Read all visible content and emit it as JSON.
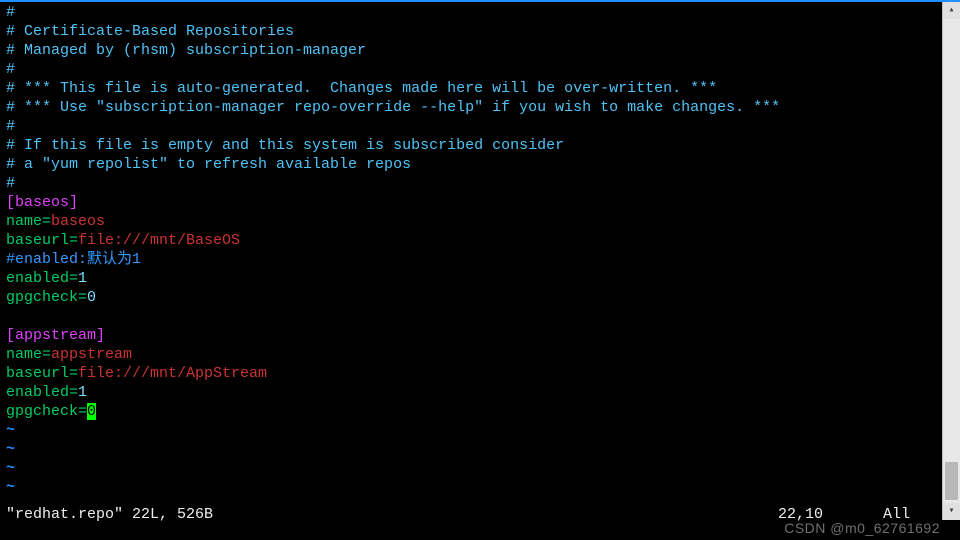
{
  "comments": {
    "l1": "#",
    "l2": "# Certificate-Based Repositories",
    "l3": "# Managed by (rhsm) subscription-manager",
    "l4": "#",
    "l5": "# *** This file is auto-generated.  Changes made here will be over-written. ***",
    "l6": "# *** Use \"subscription-manager repo-override --help\" if you wish to make changes. ***",
    "l7": "#",
    "l8": "# If this file is empty and this system is subscribed consider",
    "l9": "# a \"yum repolist\" to refresh available repos",
    "l10": "#"
  },
  "sections": {
    "baseos": {
      "header": "[baseos]",
      "name_key": "name",
      "name_val": "baseos",
      "baseurl_key": "baseurl",
      "baseurl_val": "file:///mnt/BaseOS",
      "comment": "#enabled:默认为1",
      "enabled_key": "enabled",
      "enabled_val": "1",
      "gpgcheck_key": "gpgcheck",
      "gpgcheck_val": "0"
    },
    "appstream": {
      "header": "[appstream]",
      "name_key": "name",
      "name_val": "appstream",
      "baseurl_key": "baseurl",
      "baseurl_val": "file:///mnt/AppStream",
      "enabled_key": "enabled",
      "enabled_val": "1",
      "gpgcheck_key": "gpgcheck",
      "gpgcheck_val": "0"
    }
  },
  "equals": "=",
  "tilde": "~",
  "status": {
    "filename": "\"redhat.repo\" 22L, 526B",
    "position": "22,10",
    "scroll": "All"
  },
  "watermark": "CSDN @m0_62761692"
}
